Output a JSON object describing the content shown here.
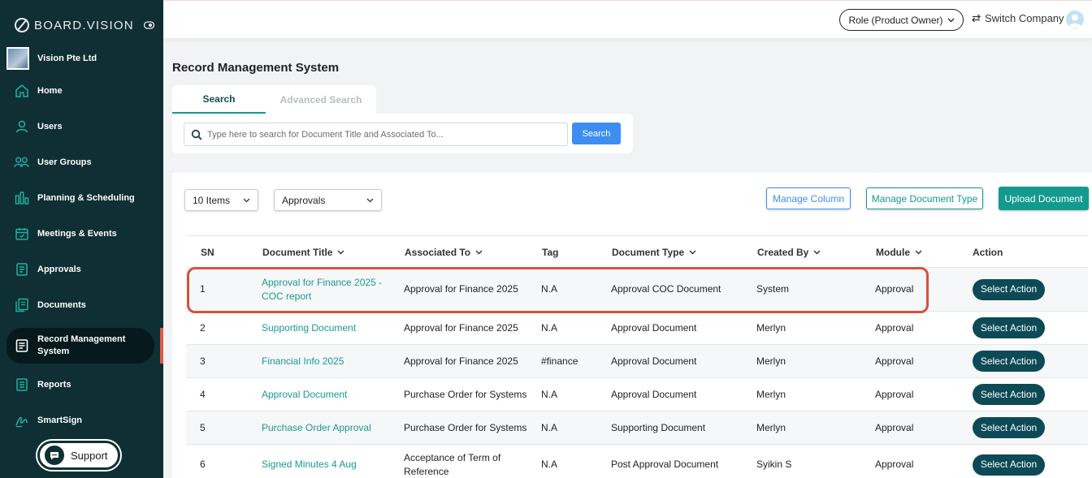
{
  "brand": {
    "name": "BOARD.VISION"
  },
  "company": {
    "name": "Vision Pte Ltd"
  },
  "nav": [
    {
      "label": "Home",
      "icon": "home-icon"
    },
    {
      "label": "Users",
      "icon": "user-icon"
    },
    {
      "label": "User Groups",
      "icon": "user-groups-icon"
    },
    {
      "label": "Planning & Scheduling",
      "icon": "bar-chart-icon"
    },
    {
      "label": "Meetings & Events",
      "icon": "calendar-icon"
    },
    {
      "label": "Approvals",
      "icon": "approvals-icon"
    },
    {
      "label": "Documents",
      "icon": "documents-icon"
    },
    {
      "label": "Record Management System",
      "icon": "record-icon",
      "active": true
    },
    {
      "label": "Reports",
      "icon": "reports-icon"
    },
    {
      "label": "SmartSign",
      "icon": "signature-icon"
    }
  ],
  "support": {
    "label": "Support"
  },
  "topbar": {
    "role": "Role (Product Owner)",
    "switch": "Switch Company"
  },
  "page": {
    "title": "Record Management System"
  },
  "search": {
    "tabs": [
      "Search",
      "Advanced Search"
    ],
    "placeholder": "Type here to search for Document Title and Associated To...",
    "button": "Search"
  },
  "toolbar": {
    "items_select": "10 Items",
    "module_select": "Approvals",
    "manage_column": "Manage Column",
    "manage_type": "Manage Document Type",
    "upload": "Upload Document"
  },
  "table": {
    "headers": [
      "SN",
      "Document Title",
      "Associated To",
      "Tag",
      "Document Type",
      "Created By",
      "Module",
      "Action"
    ],
    "rows": [
      {
        "sn": "1",
        "title": "Approval for Finance 2025 - COC report",
        "assoc": "Approval for Finance 2025",
        "tag": "N.A",
        "type": "Approval COC Document",
        "by": "System",
        "module": "Approval",
        "action": "Select Action"
      },
      {
        "sn": "2",
        "title": "Supporting Document",
        "assoc": "Approval for Finance 2025",
        "tag": "N.A",
        "type": "Approval Document",
        "by": "Merlyn",
        "module": "Approval",
        "action": "Select Action"
      },
      {
        "sn": "3",
        "title": "Financial Info 2025",
        "assoc": "Approval for Finance 2025",
        "tag": "#finance",
        "type": "Approval Document",
        "by": "Merlyn",
        "module": "Approval",
        "action": "Select Action"
      },
      {
        "sn": "4",
        "title": "Approval Document",
        "assoc": "Purchase Order for Systems",
        "tag": "N.A",
        "type": "Approval Document",
        "by": "Merlyn",
        "module": "Approval",
        "action": "Select Action"
      },
      {
        "sn": "5",
        "title": "Purchase Order Approval",
        "assoc": "Purchase Order for Systems",
        "tag": "N.A",
        "type": "Supporting Document",
        "by": "Merlyn",
        "module": "Approval",
        "action": "Select Action"
      },
      {
        "sn": "6",
        "title": "Signed Minutes 4 Aug",
        "assoc": "Acceptance of Term of Reference",
        "tag": "N.A",
        "type": "Post Approval Document",
        "by": "Syikin S",
        "module": "Approval",
        "action": "Select Action"
      }
    ]
  },
  "colors": {
    "sidebar": "#0f2f35",
    "accent": "#139a8e",
    "primary": "#3d8ef0",
    "action": "#0d4a56",
    "highlight": "#d8503f"
  }
}
